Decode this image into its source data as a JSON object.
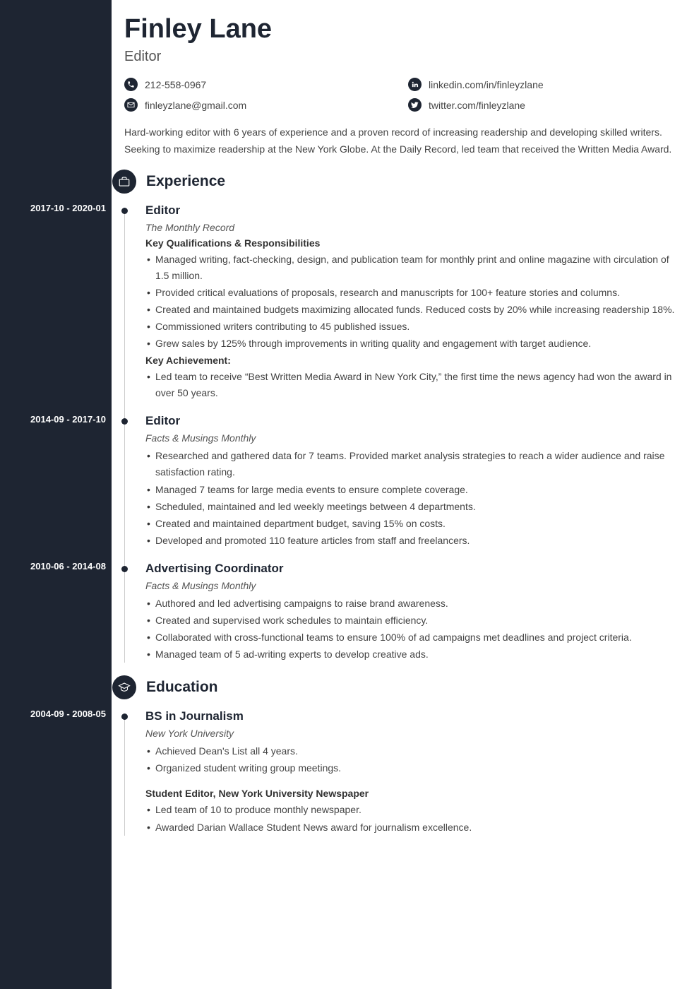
{
  "header": {
    "name": "Finley Lane",
    "title": "Editor"
  },
  "contacts": {
    "phone": "212-558-0967",
    "email": "finleyzlane@gmail.com",
    "linkedin": "linkedin.com/in/finleyzlane",
    "twitter": "twitter.com/finleyzlane"
  },
  "summary": "Hard-working editor with 6 years of experience and a proven record of increasing readership and developing skilled writers. Seeking to maximize readership at the New York Globe. At the Daily Record, led team that received the Written Media Award.",
  "sections": {
    "experience_label": "Experience",
    "education_label": "Education"
  },
  "experience": [
    {
      "dates": "2017-10 - 2020-01",
      "title": "Editor",
      "company": "The Monthly Record",
      "sub1_label": "Key Qualifications & Responsibilities",
      "bullets1": [
        "Managed writing, fact-checking, design, and publication team for monthly print and online magazine with circulation of 1.5 million.",
        "Provided critical evaluations of proposals, research and manuscripts for 100+ feature stories and columns.",
        "Created and maintained budgets maximizing allocated funds. Reduced costs by 20% while increasing readership 18%.",
        "Commissioned writers contributing to 45 published issues.",
        "Grew sales by 125% through improvements in writing quality and engagement with target audience."
      ],
      "sub2_label": "Key Achievement:",
      "bullets2": [
        "Led team to receive “Best Written Media Award in New York City,” the first time the news agency had won the award in over 50 years."
      ]
    },
    {
      "dates": "2014-09 - 2017-10",
      "title": "Editor",
      "company": "Facts & Musings Monthly",
      "bullets1": [
        "Researched and gathered data for 7 teams. Provided market analysis strategies to reach a wider audience and raise satisfaction rating.",
        "Managed 7 teams for large media events to ensure complete coverage.",
        "Scheduled, maintained and led weekly meetings between 4 departments.",
        "Created and maintained department budget, saving 15% on costs.",
        "Developed and promoted 110 feature articles from staff and freelancers."
      ]
    },
    {
      "dates": "2010-06 - 2014-08",
      "title": "Advertising Coordinator",
      "company": "Facts & Musings Monthly",
      "bullets1": [
        "Authored and led advertising campaigns to raise brand awareness.",
        "Created and supervised work schedules to maintain efficiency.",
        "Collaborated with cross-functional teams to ensure 100% of ad campaigns met deadlines and project criteria.",
        "Managed team of 5 ad-writing experts to develop creative ads."
      ]
    }
  ],
  "education": [
    {
      "dates": "2004-09 - 2008-05",
      "title": "BS in Journalism",
      "company": "New York University",
      "bullets1": [
        "Achieved Dean's List all 4 years.",
        "Organized student writing group meetings."
      ],
      "sub2_label": "Student Editor, New York University Newspaper",
      "bullets2": [
        "Led team of 10 to produce monthly newspaper.",
        "Awarded Darian Wallace Student News award for journalism excellence."
      ]
    }
  ]
}
